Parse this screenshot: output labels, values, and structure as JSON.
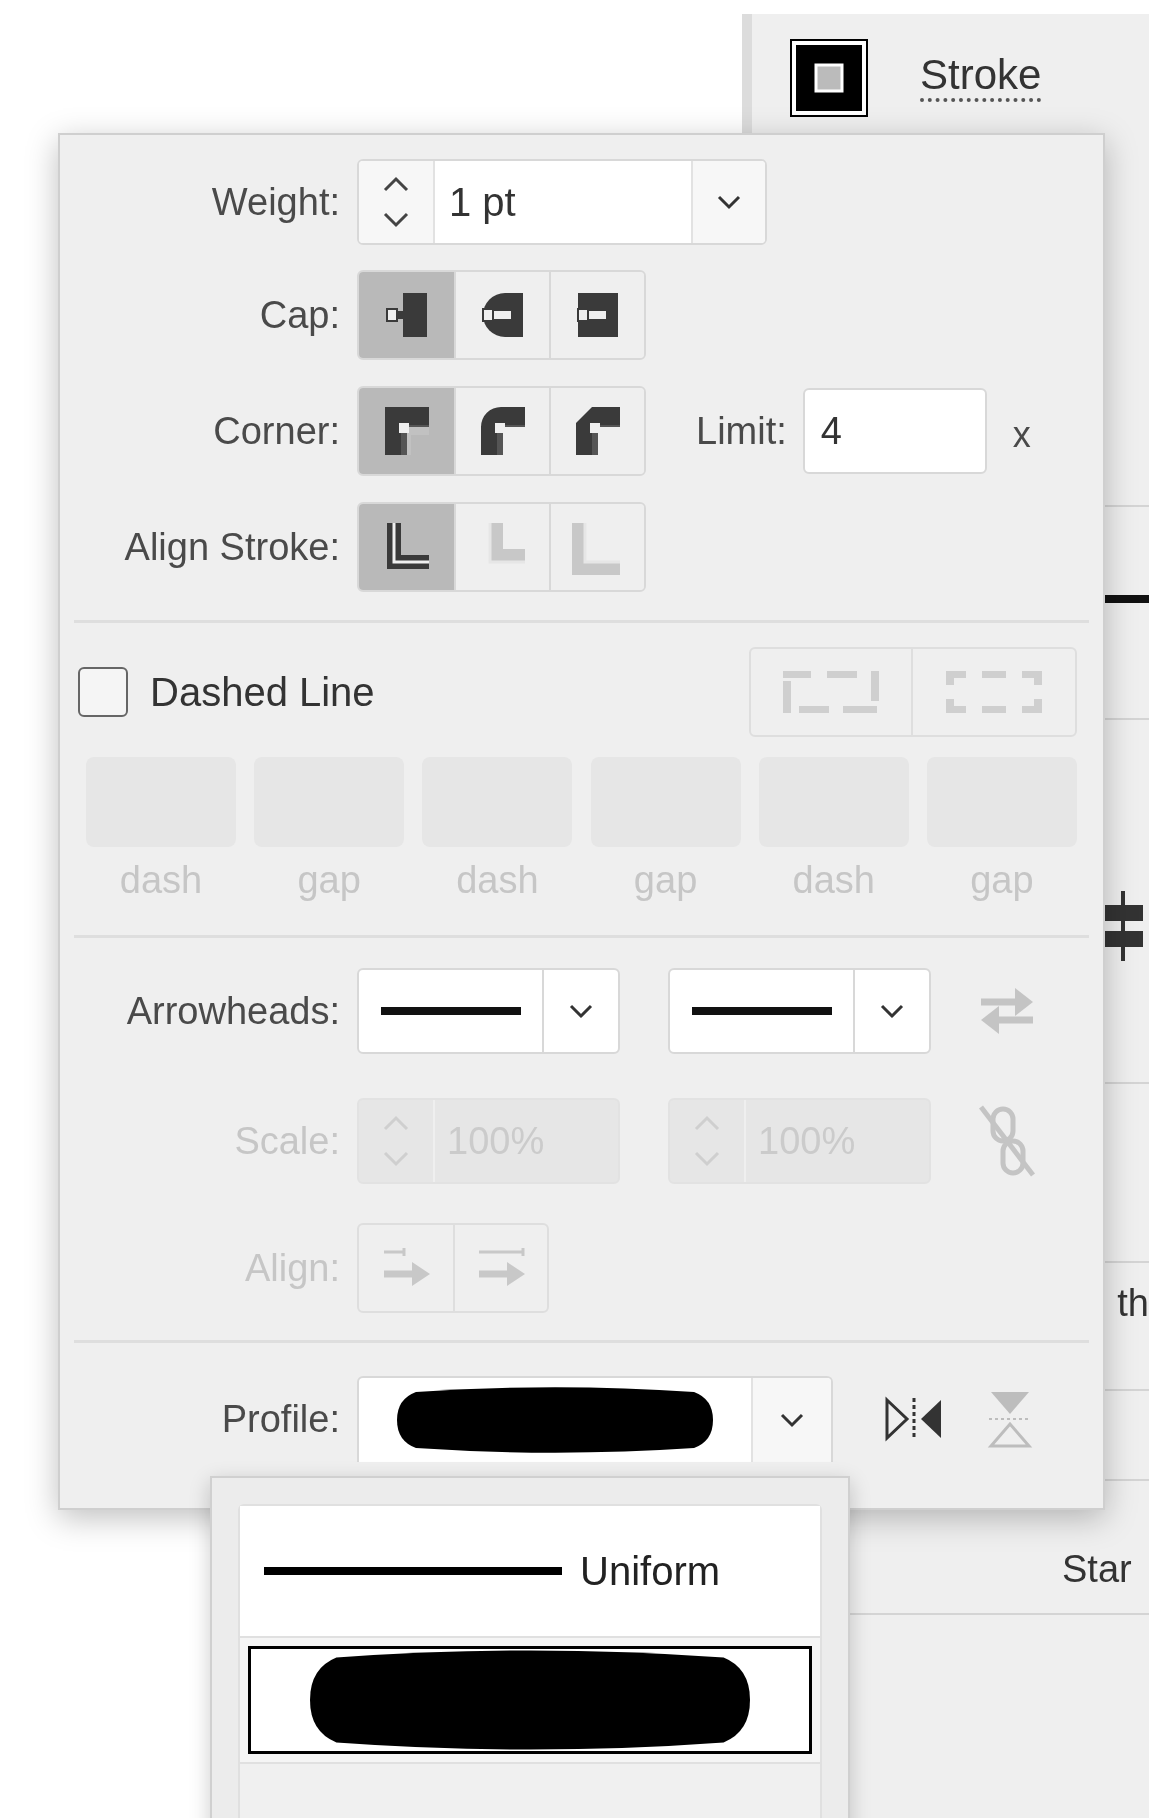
{
  "background_panel": {
    "title": "Stroke",
    "fragments": [
      "th",
      "Star"
    ]
  },
  "stroke_panel": {
    "weight": {
      "label": "Weight:",
      "value": "1 pt"
    },
    "cap": {
      "label": "Cap:",
      "options": [
        {
          "kind": "butt",
          "selected": true
        },
        {
          "kind": "round",
          "selected": false
        },
        {
          "kind": "projecting",
          "selected": false
        }
      ]
    },
    "corner": {
      "label": "Corner:",
      "options": [
        {
          "kind": "miter",
          "selected": true
        },
        {
          "kind": "round",
          "selected": false
        },
        {
          "kind": "bevel",
          "selected": false
        }
      ],
      "limit_label": "Limit:",
      "limit": "4",
      "limit_unit": "x"
    },
    "align_stroke": {
      "label": "Align Stroke:",
      "options": [
        {
          "kind": "center",
          "selected": true,
          "disabled": false
        },
        {
          "kind": "inside",
          "selected": false,
          "disabled": true
        },
        {
          "kind": "outside",
          "selected": false,
          "disabled": true
        }
      ]
    },
    "dashed_line": {
      "label": "Dashed Line",
      "checked": false,
      "disabled": true,
      "fields": [
        {
          "label": "dash"
        },
        {
          "label": "gap"
        },
        {
          "label": "dash"
        },
        {
          "label": "gap"
        },
        {
          "label": "dash"
        },
        {
          "label": "gap"
        }
      ]
    },
    "arrowheads": {
      "label": "Arrowheads:"
    },
    "scale": {
      "label": "Scale:",
      "start": "100%",
      "end": "100%",
      "disabled": true
    },
    "align": {
      "label": "Align:",
      "disabled": true
    },
    "profile": {
      "label": "Profile:"
    }
  },
  "profile_menu": {
    "items": [
      {
        "kind": "uniform",
        "label": "Uniform",
        "selected": false
      },
      {
        "kind": "width",
        "selected": true
      }
    ]
  }
}
